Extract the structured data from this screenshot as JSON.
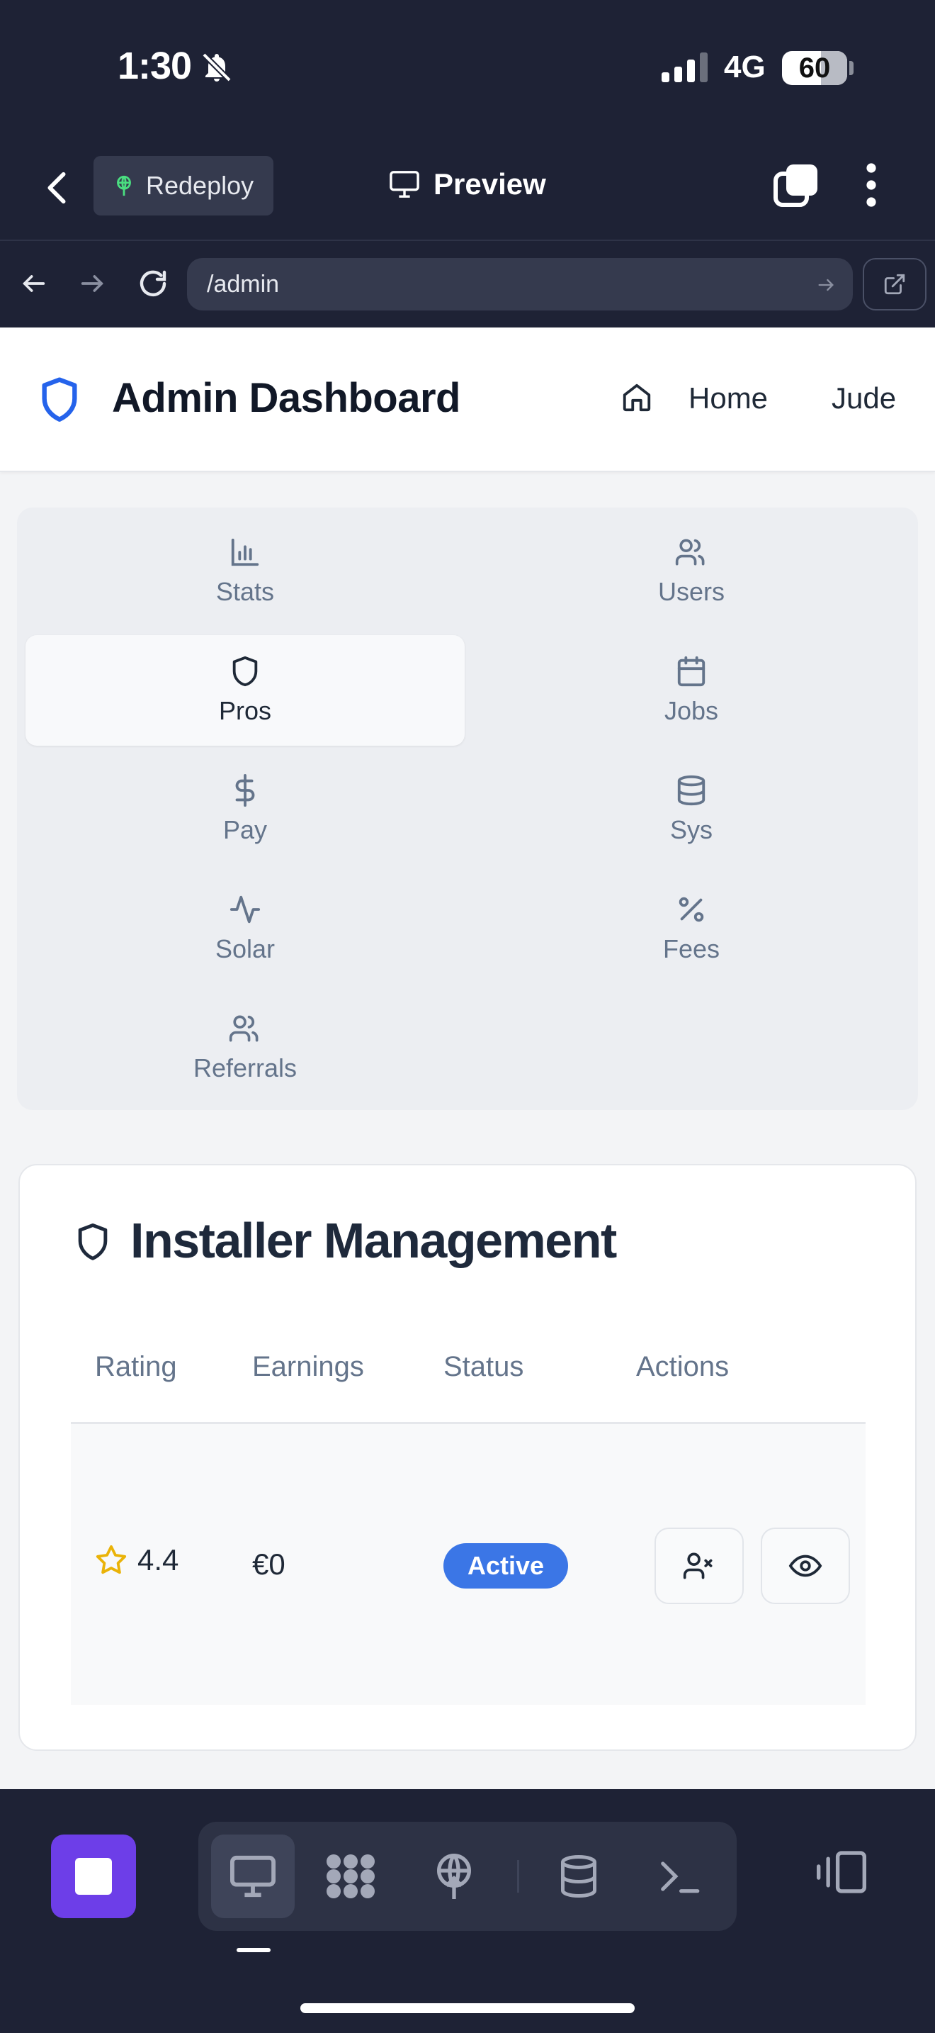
{
  "status_bar": {
    "time": "1:30",
    "network": "4G",
    "battery": "60",
    "battery_level": 0.6
  },
  "app_bar": {
    "redeploy_label": "Redeploy",
    "preview_label": "Preview"
  },
  "url_bar": {
    "url": "/admin"
  },
  "header": {
    "title": "Admin Dashboard",
    "home_label": "Home",
    "user_name": "Jude"
  },
  "nav": {
    "items": [
      {
        "label": "Stats",
        "icon": "bar-chart-icon",
        "active": false
      },
      {
        "label": "Users",
        "icon": "users-icon",
        "active": false
      },
      {
        "label": "Pros",
        "icon": "shield-icon",
        "active": true
      },
      {
        "label": "Jobs",
        "icon": "calendar-icon",
        "active": false
      },
      {
        "label": "Pay",
        "icon": "dollar-icon",
        "active": false
      },
      {
        "label": "Sys",
        "icon": "database-icon",
        "active": false
      },
      {
        "label": "Solar",
        "icon": "activity-icon",
        "active": false
      },
      {
        "label": "Fees",
        "icon": "percent-icon",
        "active": false
      },
      {
        "label": "Referrals",
        "icon": "users-icon",
        "active": false
      }
    ]
  },
  "installer_card": {
    "title": "Installer Management",
    "columns": [
      "Rating",
      "Earnings",
      "Status",
      "Actions"
    ],
    "rows": [
      {
        "rating": "4.4",
        "earnings": "€0",
        "status": "Active",
        "actions": [
          "deactivate-user-icon",
          "eye-icon"
        ]
      }
    ]
  },
  "dock": {
    "buttons": [
      "monitor-icon",
      "apps-icon",
      "deploy-icon",
      "database-icon",
      "terminal-icon"
    ],
    "active": "monitor-icon"
  },
  "colors": {
    "chrome_bg": "#1e2235",
    "accent_blue": "#3b76e6",
    "stop_purple": "#6d3ee8",
    "star_yellow": "#eab308"
  }
}
